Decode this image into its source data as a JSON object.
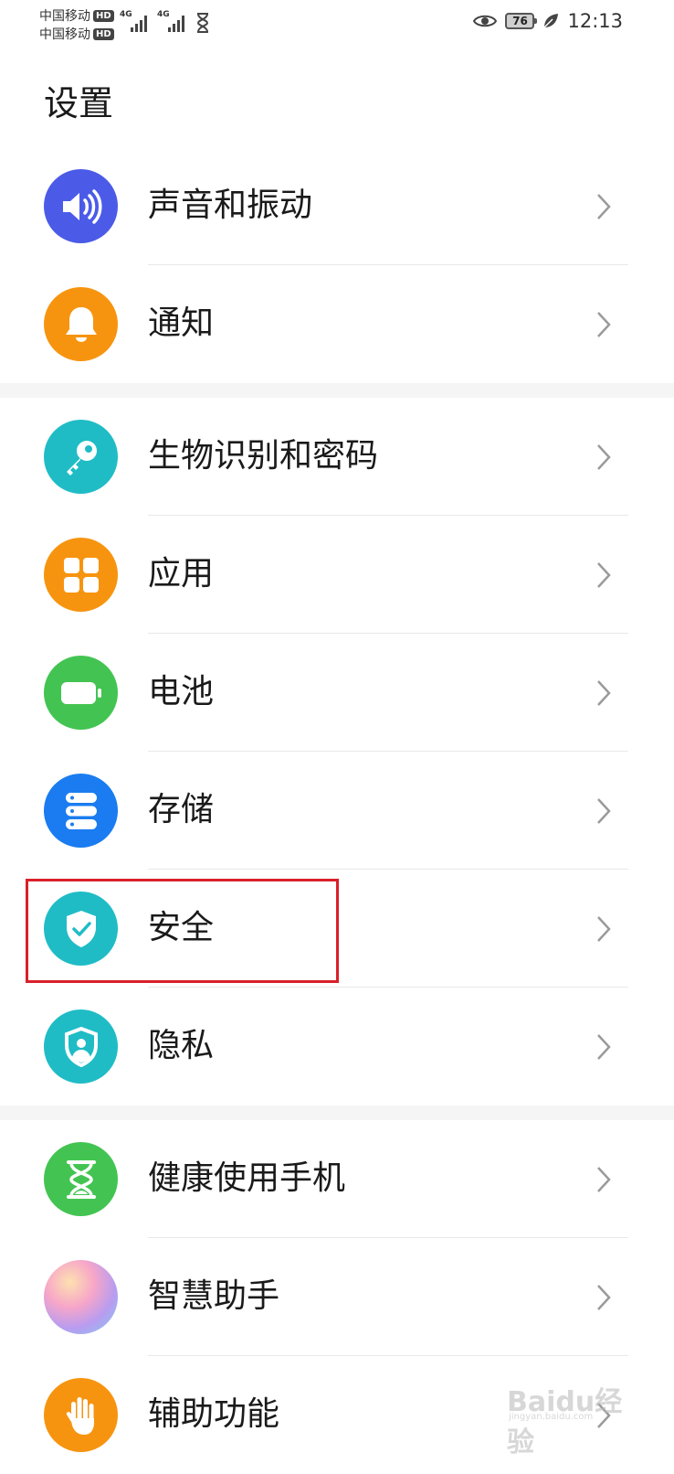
{
  "status_bar": {
    "carrier_1": "中国移动",
    "carrier_2": "中国移动",
    "hd_badge": "HD",
    "network_1": "4G",
    "network_2": "4G",
    "battery_level": "76",
    "time": "12:13",
    "icons": [
      "signal-bars-icon",
      "hourglass-icon",
      "eye-icon",
      "battery-icon",
      "leaf-icon"
    ]
  },
  "page_title": "设置",
  "settings": {
    "sound": {
      "label": "声音和振动",
      "icon": "speaker-icon",
      "color": "#4b5be8"
    },
    "notifications": {
      "label": "通知",
      "icon": "bell-icon",
      "color": "#f7940f"
    },
    "biometrics": {
      "label": "生物识别和密码",
      "icon": "key-icon",
      "color": "#1fbcc6"
    },
    "apps": {
      "label": "应用",
      "icon": "grid-icon",
      "color": "#f7940f"
    },
    "battery": {
      "label": "电池",
      "icon": "battery-icon",
      "color": "#43c452"
    },
    "storage": {
      "label": "存储",
      "icon": "storage-icon",
      "color": "#1a7cf0"
    },
    "security": {
      "label": "安全",
      "icon": "shield-check-icon",
      "color": "#1fbcc6"
    },
    "privacy": {
      "label": "隐私",
      "icon": "shield-user-icon",
      "color": "#1fbcc6"
    },
    "digital_balance": {
      "label": "健康使用手机",
      "icon": "hourglass-icon",
      "color": "#43c452"
    },
    "assistant": {
      "label": "智慧助手",
      "icon": "gradient-orb-icon",
      "color": "#c98be0"
    },
    "accessibility": {
      "label": "辅助功能",
      "icon": "hand-icon",
      "color": "#f7940f"
    }
  },
  "highlight": {
    "target": "security",
    "color": "#d9202a"
  },
  "watermark": {
    "text": "Baidu经验",
    "sub": "jingyan.baidu.com"
  }
}
